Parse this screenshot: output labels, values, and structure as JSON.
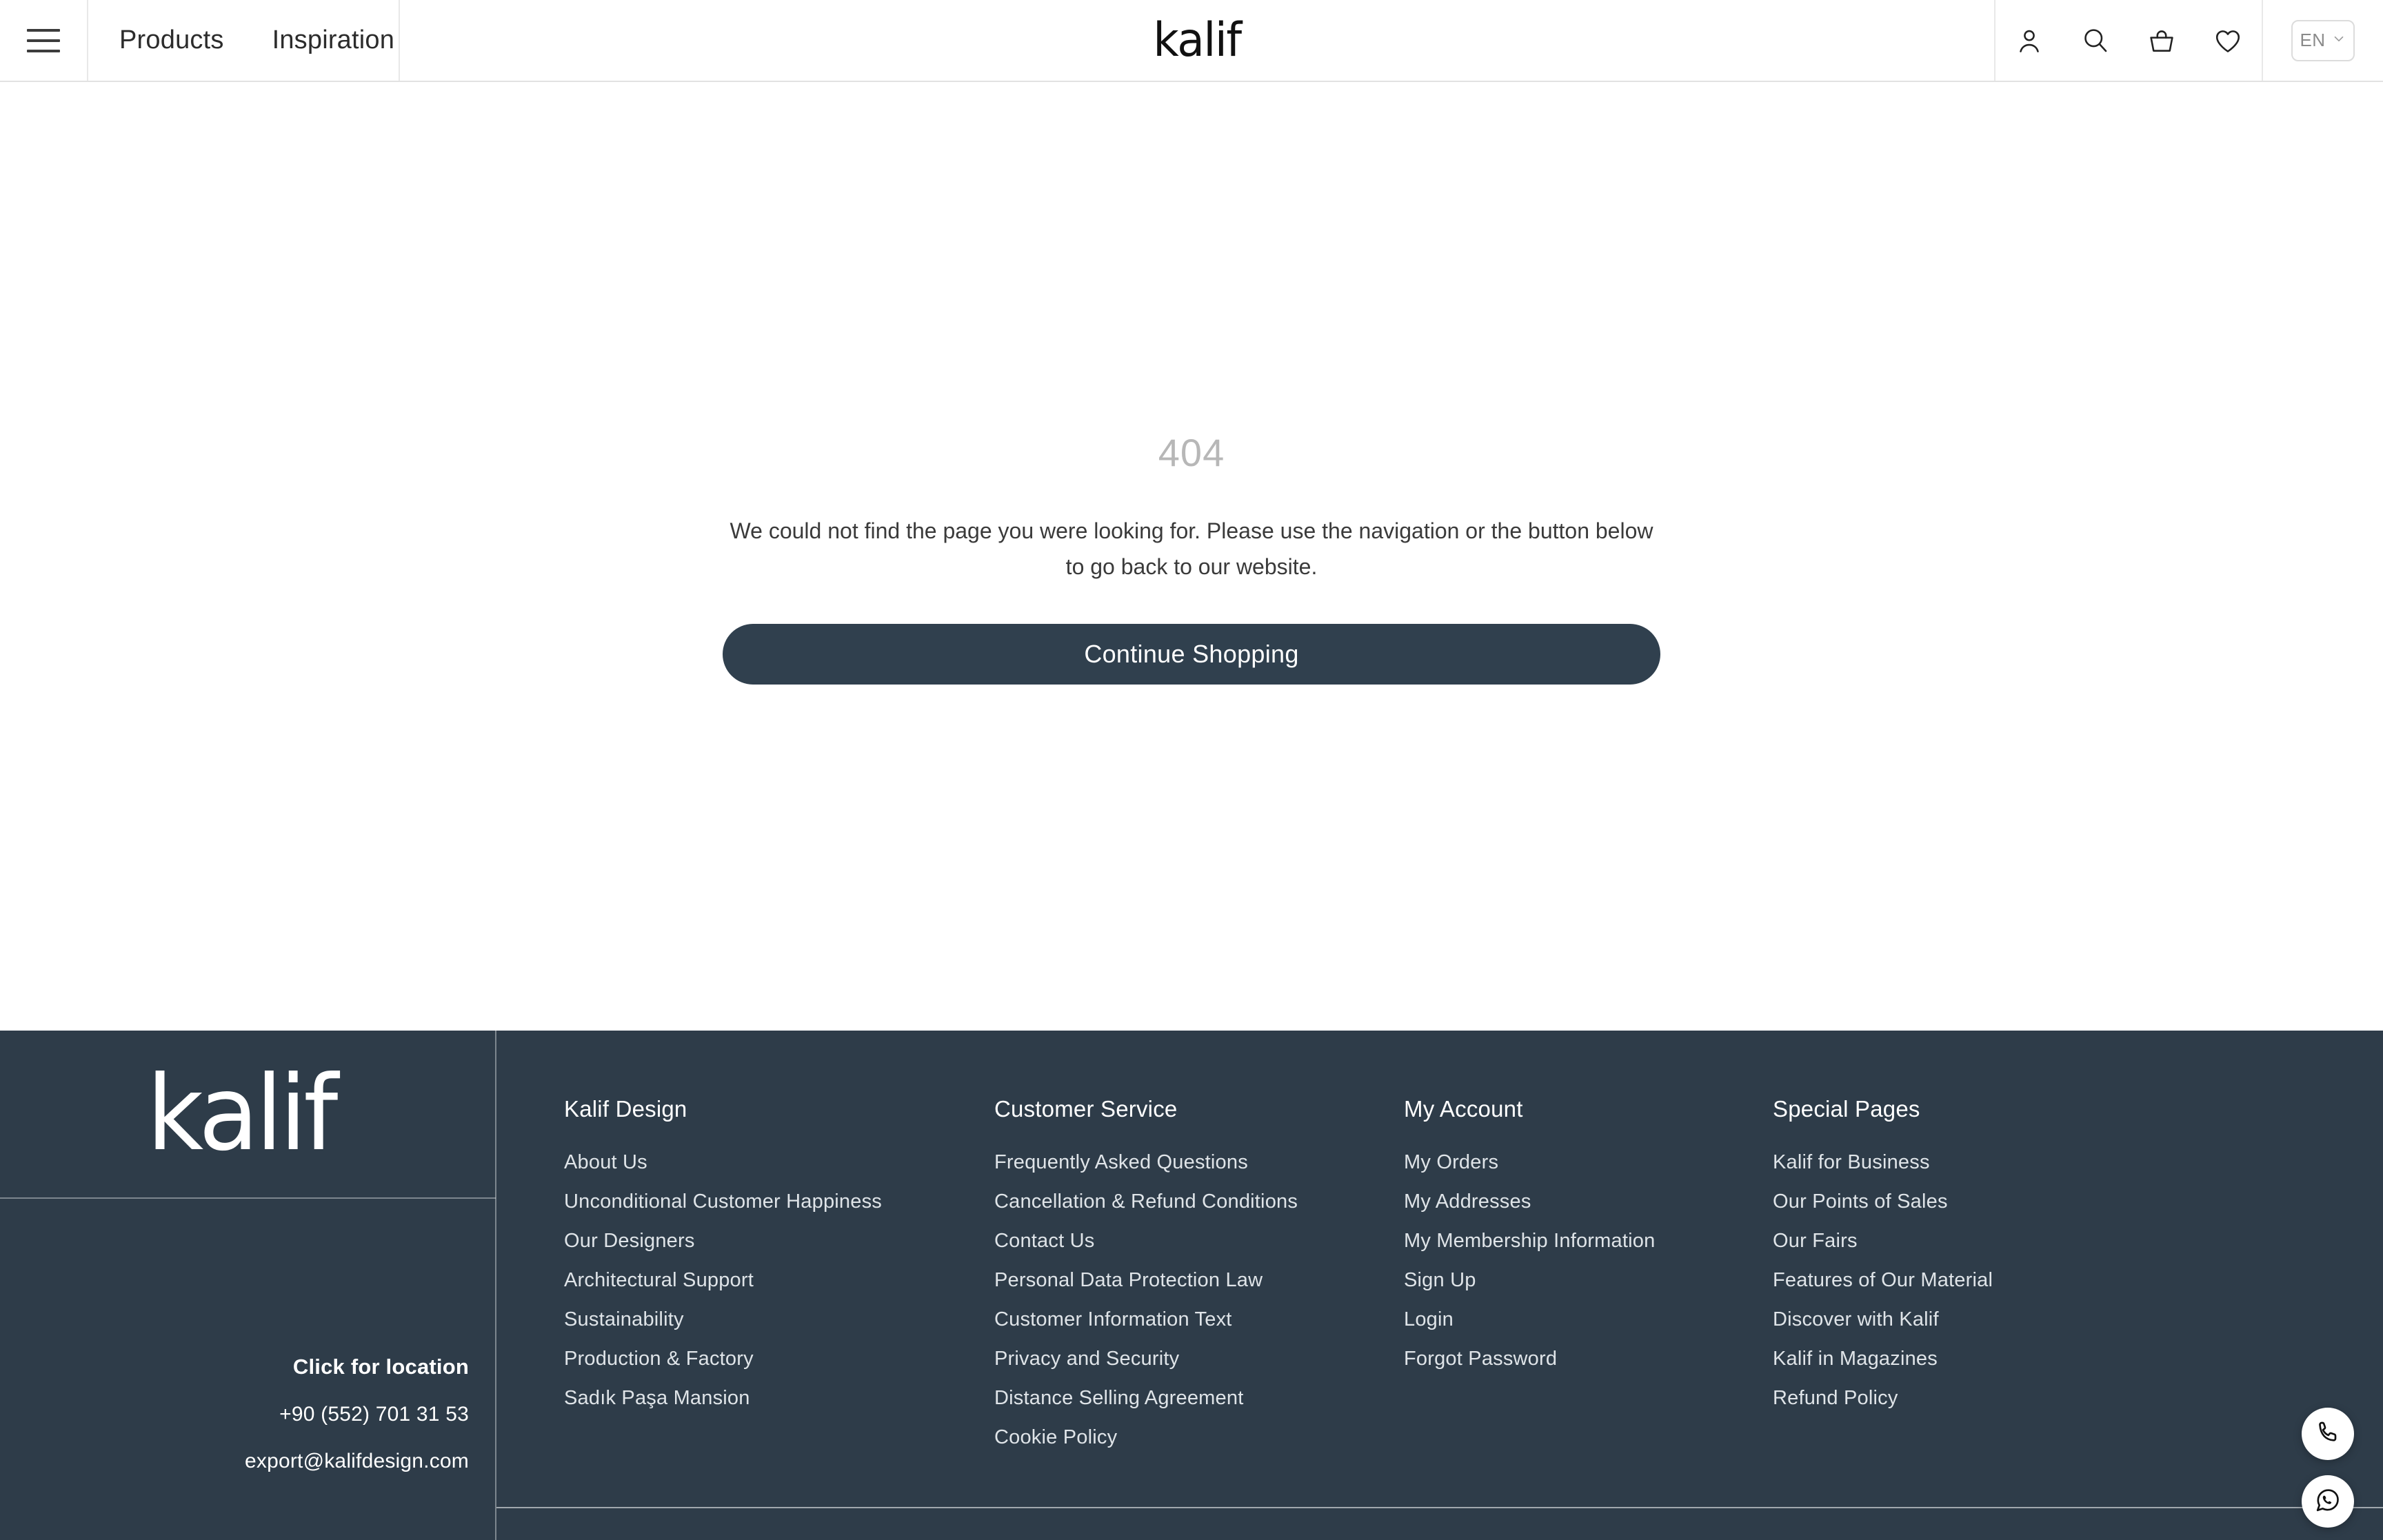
{
  "header": {
    "menu_icon": "hamburger-menu-icon",
    "nav": [
      {
        "label": "Products"
      },
      {
        "label": "Inspiration"
      }
    ],
    "logo": "kalif",
    "icons": [
      {
        "name": "account-icon",
        "label": "Account"
      },
      {
        "name": "search-icon",
        "label": "Search"
      },
      {
        "name": "basket-icon",
        "label": "Cart"
      },
      {
        "name": "heart-icon",
        "label": "Wishlist"
      }
    ],
    "language": {
      "value": "EN",
      "chevron": "chevron-down-icon"
    }
  },
  "main": {
    "error_code": "404",
    "message": "We could not find the page you were looking for. Please use the navigation or the button below to go back to our website.",
    "cta_label": "Continue Shopping"
  },
  "footer": {
    "logo": "kalif",
    "contact": {
      "location_label": "Click for location",
      "phone": "+90 (552) 701 31 53",
      "email": "export@kalifdesign.com"
    },
    "columns": [
      {
        "title": "Kalif Design",
        "links": [
          "About Us",
          "Unconditional Customer Happiness",
          "Our Designers",
          "Architectural Support",
          "Sustainability",
          "Production & Factory",
          "Sadık Paşa Mansion"
        ]
      },
      {
        "title": "Customer Service",
        "links": [
          "Frequently Asked Questions",
          "Cancellation & Refund Conditions",
          "Contact Us",
          "Personal Data Protection Law",
          "Customer Information Text",
          "Privacy and Security",
          "Distance Selling Agreement",
          "Cookie Policy"
        ]
      },
      {
        "title": "My Account",
        "links": [
          "My Orders",
          "My Addresses",
          "My Membership Information",
          "Sign Up",
          "Login",
          "Forgot Password"
        ]
      },
      {
        "title": "Special Pages",
        "links": [
          "Kalif for Business",
          "Our Points of Sales",
          "Our Fairs",
          "Features of Our Material",
          "Discover with Kalif",
          "Kalif in Magazines",
          "Refund Policy"
        ]
      }
    ]
  },
  "floating_actions": [
    {
      "name": "phone-icon",
      "label": "Call"
    },
    {
      "name": "whatsapp-icon",
      "label": "WhatsApp"
    }
  ],
  "colors": {
    "dark": "#2e3c49",
    "button": "#30404e",
    "error_code": "#b7b7b7",
    "body_text": "#3a3a3a"
  }
}
